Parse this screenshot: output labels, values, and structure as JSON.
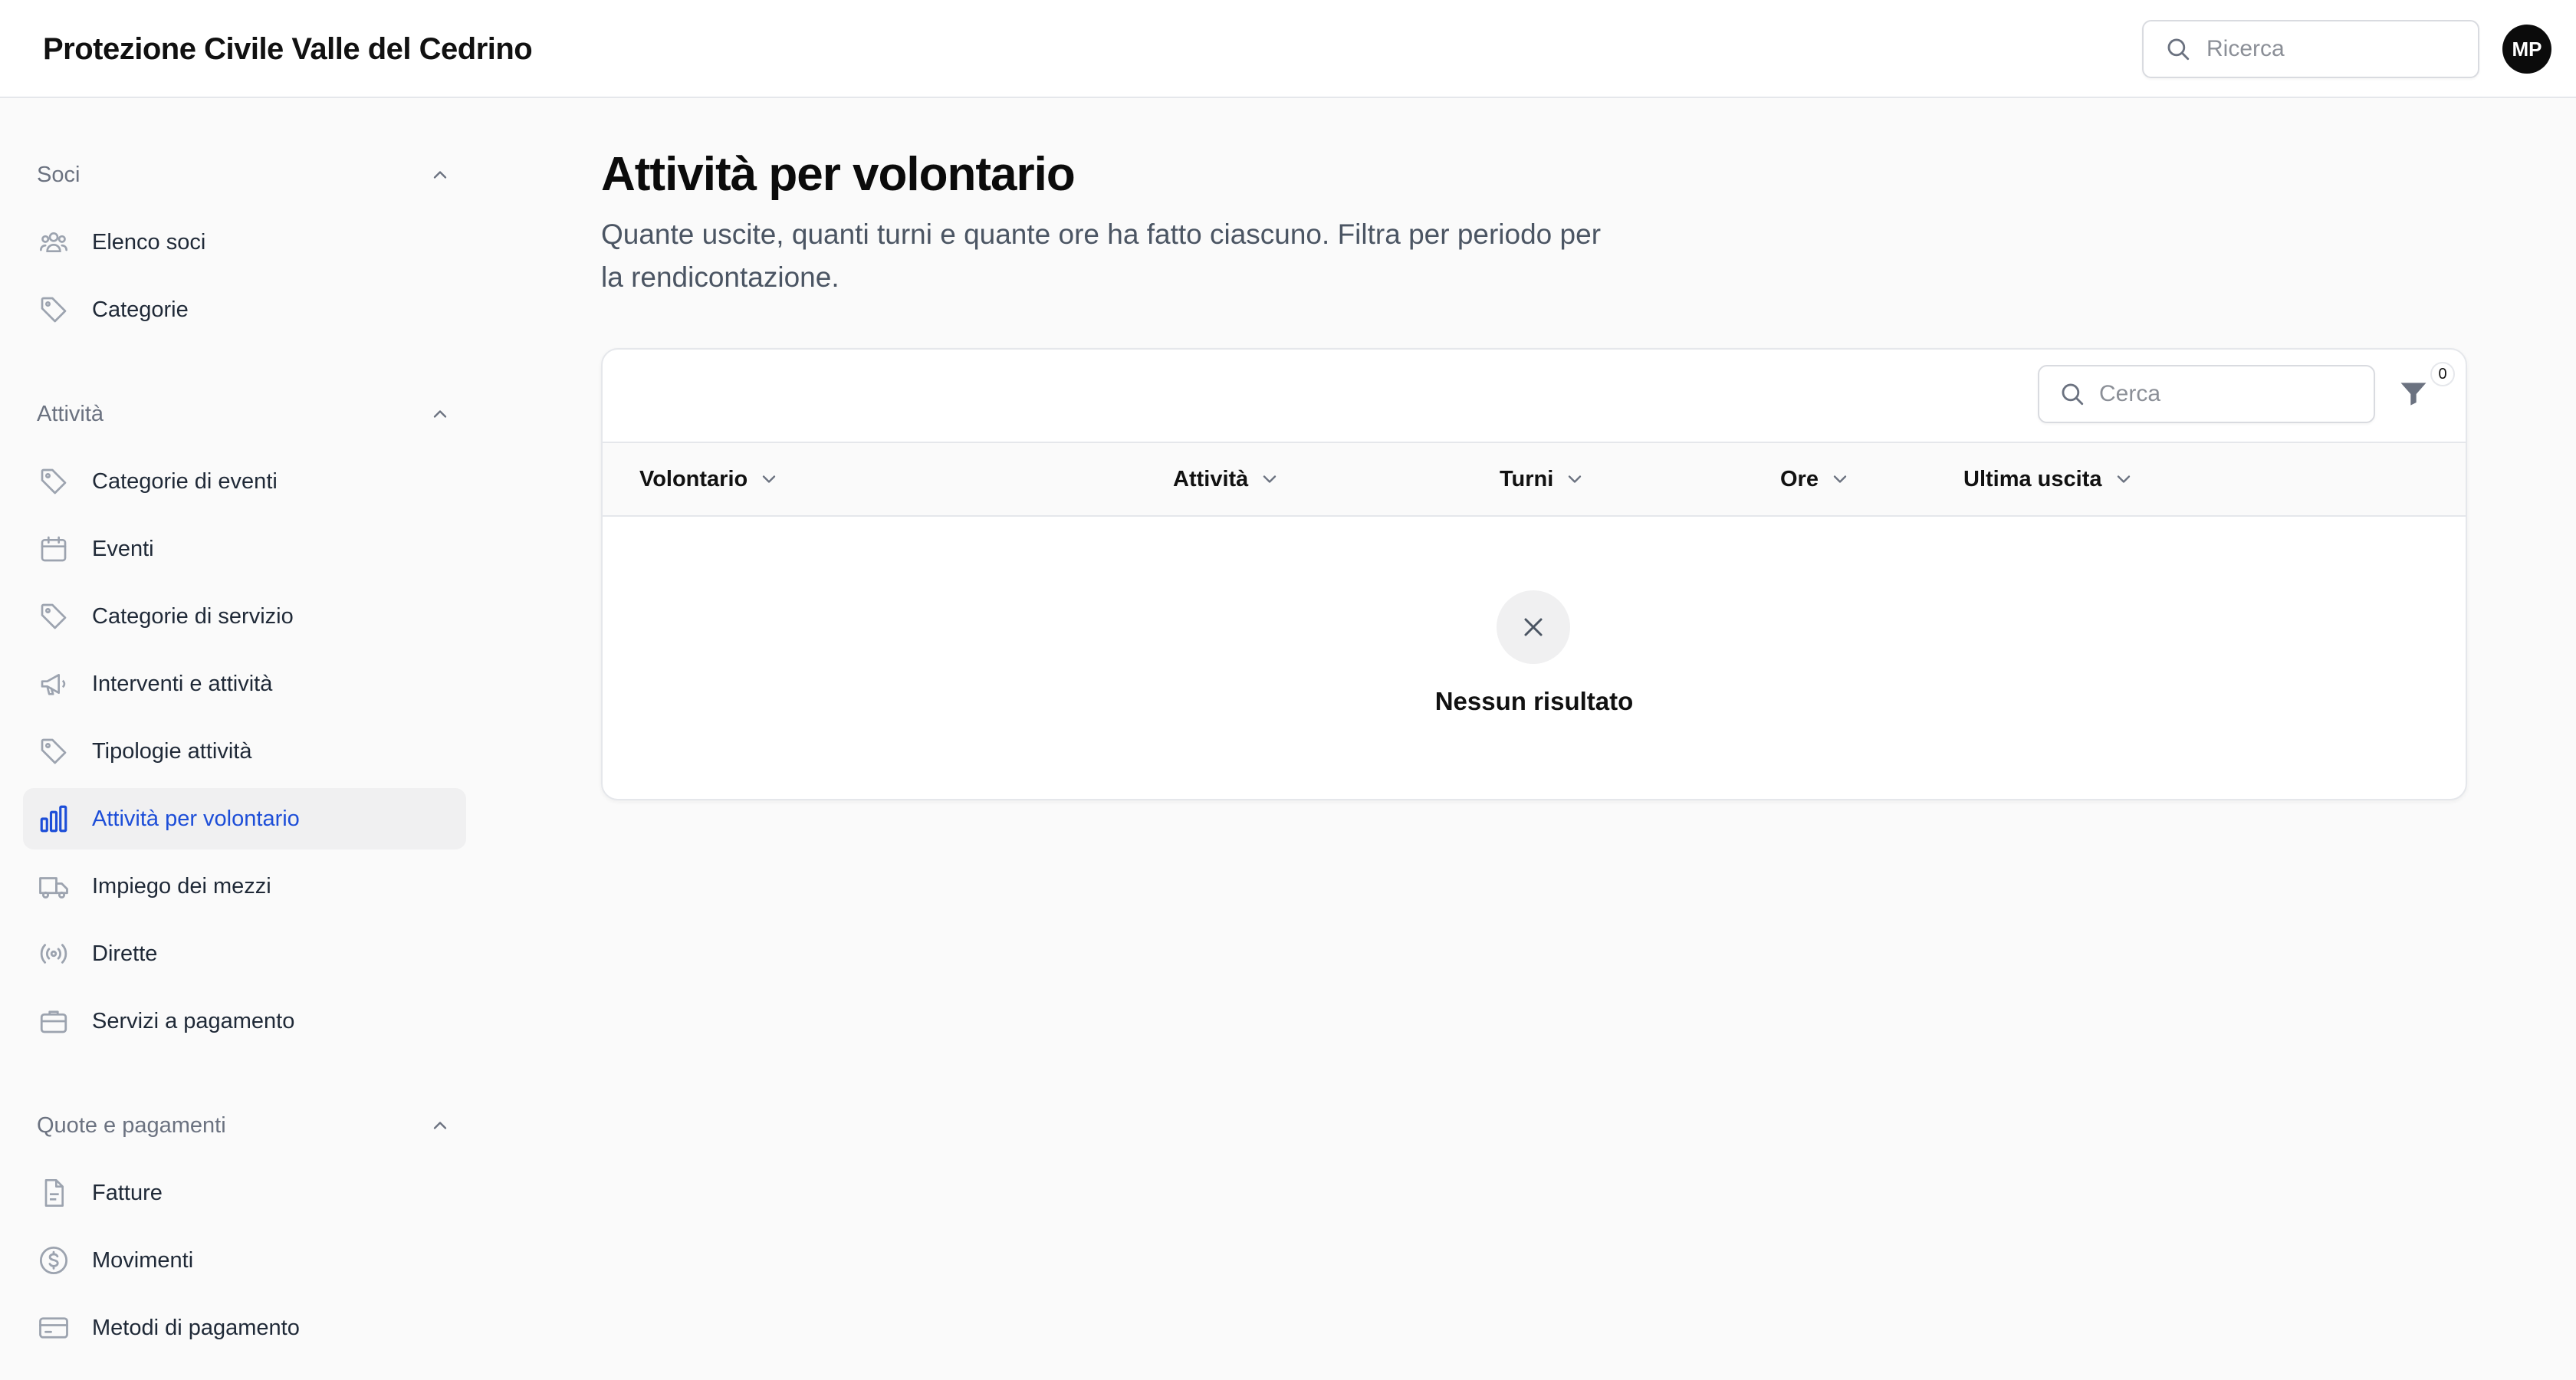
{
  "app": {
    "title": "Protezione Civile Valle del Cedrino"
  },
  "header": {
    "search_placeholder": "Ricerca",
    "avatar_initials": "MP"
  },
  "sidebar": {
    "groups": [
      {
        "label": "Soci",
        "items": [
          {
            "label": "Elenco soci",
            "icon": "users-icon"
          },
          {
            "label": "Categorie",
            "icon": "tag-icon"
          }
        ]
      },
      {
        "label": "Attività",
        "items": [
          {
            "label": "Categorie di eventi",
            "icon": "tag-icon"
          },
          {
            "label": "Eventi",
            "icon": "calendar-icon"
          },
          {
            "label": "Categorie di servizio",
            "icon": "tag-icon"
          },
          {
            "label": "Interventi e attività",
            "icon": "megaphone-icon"
          },
          {
            "label": "Tipologie attività",
            "icon": "tag-icon"
          },
          {
            "label": "Attività per volontario",
            "icon": "bar-chart-icon",
            "active": true
          },
          {
            "label": "Impiego dei mezzi",
            "icon": "truck-icon"
          },
          {
            "label": "Dirette",
            "icon": "broadcast-icon"
          },
          {
            "label": "Servizi a pagamento",
            "icon": "briefcase-icon"
          }
        ]
      },
      {
        "label": "Quote e pagamenti",
        "items": [
          {
            "label": "Fatture",
            "icon": "document-icon"
          },
          {
            "label": "Movimenti",
            "icon": "dollar-icon"
          },
          {
            "label": "Metodi di pagamento",
            "icon": "credit-card-icon"
          }
        ]
      }
    ]
  },
  "page": {
    "title": "Attività per volontario",
    "subtitle": "Quante uscite, quanti turni e quante ore ha fatto ciascuno. Filtra per periodo per la rendicontazione."
  },
  "table": {
    "search_placeholder": "Cerca",
    "filter_count": "0",
    "columns": [
      "Volontario",
      "Attività",
      "Turni",
      "Ore",
      "Ultima uscita"
    ],
    "rows": [],
    "empty_text": "Nessun risultato"
  },
  "colors": {
    "accent": "#1d4ed8",
    "active_bg": "#f0f0f1"
  }
}
